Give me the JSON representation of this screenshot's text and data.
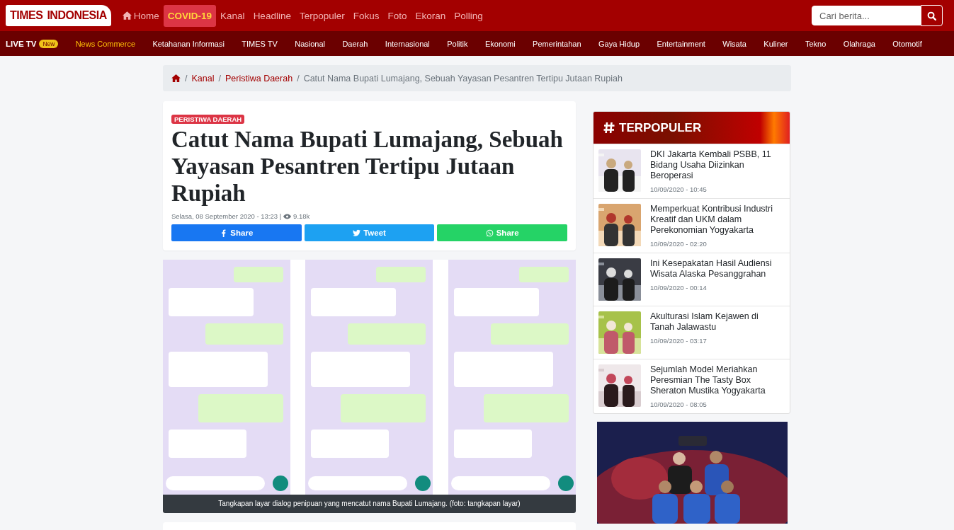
{
  "header": {
    "logo": {
      "part_1": "TIMES",
      "part_2": "INDONESIA"
    },
    "nav": [
      {
        "label": "Home",
        "kind": "home",
        "selected": false
      },
      {
        "label": "COVID-19",
        "kind": "text",
        "selected": true
      },
      {
        "label": "Kanal",
        "kind": "text",
        "selected": false
      },
      {
        "label": "Headline",
        "kind": "text",
        "selected": false
      },
      {
        "label": "Terpopuler",
        "kind": "text",
        "selected": false
      },
      {
        "label": "Fokus",
        "kind": "text",
        "selected": false
      },
      {
        "label": "Foto",
        "kind": "text",
        "selected": false
      },
      {
        "label": "Ekoran",
        "kind": "text",
        "selected": false
      },
      {
        "label": "Polling",
        "kind": "text",
        "selected": false
      }
    ],
    "search": {
      "placeholder": "Cari berita..."
    }
  },
  "subnav": {
    "live": {
      "label": "LIVE TV",
      "badge": "New"
    },
    "items": [
      {
        "label": "News Commerce",
        "highlighted": true
      },
      {
        "label": "Ketahanan Informasi",
        "highlighted": false
      },
      {
        "label": "TIMES TV",
        "highlighted": false
      },
      {
        "label": "Nasional",
        "highlighted": false
      },
      {
        "label": "Daerah",
        "highlighted": false
      },
      {
        "label": "Internasional",
        "highlighted": false
      },
      {
        "label": "Politik",
        "highlighted": false
      },
      {
        "label": "Ekonomi",
        "highlighted": false
      },
      {
        "label": "Pemerintahan",
        "highlighted": false
      },
      {
        "label": "Gaya Hidup",
        "highlighted": false
      },
      {
        "label": "Entertainment",
        "highlighted": false
      },
      {
        "label": "Wisata",
        "highlighted": false
      },
      {
        "label": "Kuliner",
        "highlighted": false
      },
      {
        "label": "Tekno",
        "highlighted": false
      },
      {
        "label": "Olahraga",
        "highlighted": false
      },
      {
        "label": "Otomotif",
        "highlighted": false
      }
    ]
  },
  "breadcrumb": {
    "separator": "/",
    "links": [
      "Kanal",
      "Peristiwa Daerah"
    ],
    "current": "Catut Nama Bupati Lumajang, Sebuah Yayasan Pesantren Tertipu Jutaan Rupiah"
  },
  "article": {
    "category": "PERISTIWA DAERAH",
    "title": "Catut Nama Bupati Lumajang, Sebuah Yayasan Pesantren Tertipu Jutaan Rupiah",
    "date": "Selasa, 08 September 2020 - 13:23 |",
    "views": "9.18k",
    "share": [
      {
        "label": "Share",
        "kind": "facebook"
      },
      {
        "label": "Tweet",
        "kind": "twitter"
      },
      {
        "label": "Share",
        "kind": "whatsapp"
      }
    ],
    "caption": "Tangkapan layar dialog penipuan yang mencatut nama Bupati Lumajang. (foto: tangkapan layar)"
  },
  "sidebar": {
    "title": "TERPOPULER",
    "items": [
      {
        "title": "DKI Jakarta Kembali PSBB, 11 Bidang Usaha Diizinkan Beroperasi",
        "time": "10/09/2020 - 10:45"
      },
      {
        "title": "Memperkuat Kontribusi Industri Kreatif dan UKM dalam Perekonomian Yogyakarta",
        "time": "10/09/2020 - 02:20"
      },
      {
        "title": "Ini Kesepakatan Hasil Audiensi Wisata Alaska Pesanggrahan",
        "time": "10/09/2020 - 00:14"
      },
      {
        "title": "Akulturasi Islam Kejawen di Tanah Jalawastu",
        "time": "10/09/2020 - 03:17"
      },
      {
        "title": "Sejumlah Model Meriahkan Peresmian The Tasty Box Sheraton Mustika Yogyakarta",
        "time": "10/09/2020 - 08:05"
      }
    ]
  }
}
